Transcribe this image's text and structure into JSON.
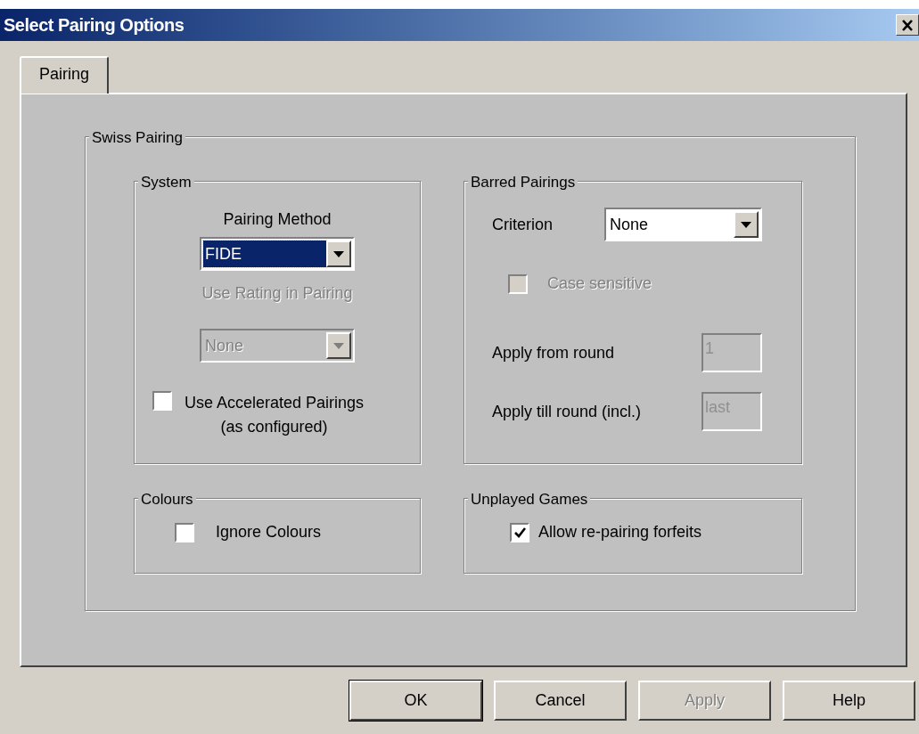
{
  "window": {
    "title": "Select Pairing Options"
  },
  "tabs": [
    {
      "label": "Pairing",
      "selected": true
    }
  ],
  "swiss_pairing": {
    "title": "Swiss Pairing",
    "system": {
      "title": "System",
      "pairing_method": {
        "label": "Pairing Method",
        "value": "FIDE",
        "focused": true,
        "disabled": false
      },
      "rating": {
        "label": "Use Rating in Pairing",
        "value": "None",
        "focused": false,
        "disabled": true
      },
      "accelerated": {
        "label": "Use Accelerated Pairings",
        "sublabel": "(as configured)",
        "checked": false,
        "disabled": false
      }
    },
    "barred_pairings": {
      "title": "Barred Pairings",
      "criterion": {
        "label": "Criterion",
        "value": "None",
        "focused": false,
        "disabled": false
      },
      "case_sensitive": {
        "label": "Case sensitive",
        "checked": false,
        "disabled": true
      },
      "fields": [
        {
          "label": "Apply from round",
          "value": "1",
          "disabled": true
        },
        {
          "label": "Apply till round (incl.)",
          "value": "last",
          "disabled": true
        }
      ]
    },
    "colours": {
      "title": "Colours",
      "checkbox": {
        "label": "Ignore Colours",
        "checked": false,
        "disabled": false
      }
    },
    "unplayed_games": {
      "title": "Unplayed Games",
      "checkbox": {
        "label": "Allow re-pairing forfeits",
        "checked": true,
        "disabled": false
      }
    }
  },
  "buttons": [
    {
      "label": "OK",
      "default": true,
      "disabled": false
    },
    {
      "label": "Cancel",
      "default": false,
      "disabled": false
    },
    {
      "label": "Apply",
      "default": false,
      "disabled": true
    },
    {
      "label": "Help",
      "default": false,
      "disabled": false
    }
  ]
}
